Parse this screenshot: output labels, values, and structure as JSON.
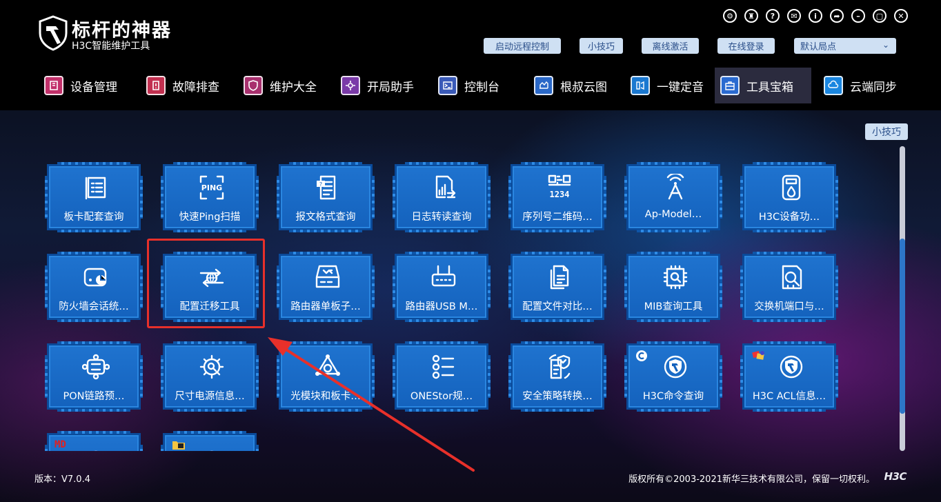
{
  "app": {
    "title": "标杆的神器",
    "subtitle": "H3C智能维护工具"
  },
  "window_controls": [
    {
      "name": "settings-icon",
      "glyph": "⚙"
    },
    {
      "name": "skin-icon",
      "glyph": "♜"
    },
    {
      "name": "help-icon",
      "glyph": "?"
    },
    {
      "name": "mail-icon",
      "glyph": "✉"
    },
    {
      "name": "info-icon",
      "glyph": "i"
    },
    {
      "name": "share-icon",
      "glyph": "➦"
    },
    {
      "name": "minimize-icon",
      "glyph": "–"
    },
    {
      "name": "maximize-icon",
      "glyph": "▢"
    },
    {
      "name": "close-icon",
      "glyph": "✕"
    }
  ],
  "quick_buttons": {
    "remote": "启动远程控制",
    "tips": "小技巧",
    "offline_activate": "离线激活",
    "online_login": "在线登录",
    "office_select": "默认局点"
  },
  "nav": [
    {
      "label": "设备管理",
      "color": "#c2306a"
    },
    {
      "label": "故障排查",
      "color": "#c23050"
    },
    {
      "label": "维护大全",
      "color": "#a8306e"
    },
    {
      "label": "开局助手",
      "color": "#7a3aa8"
    },
    {
      "label": "控制台",
      "color": "#3a5ab8"
    },
    {
      "label": "根叔云图",
      "color": "#2a68c8"
    },
    {
      "label": "一键定音",
      "color": "#1a78d0"
    },
    {
      "label": "工具宝箱",
      "color": "#2a6ad0"
    },
    {
      "label": "云端同步",
      "color": "#1a86e0"
    }
  ],
  "active_nav": "工具宝箱",
  "tips_badge": "小技巧",
  "scroll_position": 0.31,
  "tools": [
    {
      "label": "板卡配套查询",
      "icon": "list-icon"
    },
    {
      "label": "快速Ping扫描",
      "icon": "ping-scan-icon",
      "icon_text": "PING"
    },
    {
      "label": "报文格式查询",
      "icon": "document-query-icon"
    },
    {
      "label": "日志转读查询",
      "icon": "log-icon"
    },
    {
      "label": "序列号二维码…",
      "icon": "qr-code-icon",
      "icon_text": "1234"
    },
    {
      "label": "Ap-Model…",
      "icon": "antenna-icon"
    },
    {
      "label": "H3C设备功…",
      "icon": "device-power-icon"
    },
    {
      "label": "防火墙会话统…",
      "icon": "firewall-chart-icon"
    },
    {
      "label": "配置迁移工具",
      "icon": "config-migrate-icon"
    },
    {
      "label": "路由器单板子…",
      "icon": "router-board-icon"
    },
    {
      "label": "路由器USB M…",
      "icon": "router-usb-icon"
    },
    {
      "label": "配置文件对比…",
      "icon": "file-compare-icon"
    },
    {
      "label": "MIB查询工具",
      "icon": "mib-chip-icon"
    },
    {
      "label": "交换机端口与…",
      "icon": "switch-port-icon"
    },
    {
      "label": "PON链路预…",
      "icon": "pon-link-icon"
    },
    {
      "label": "尺寸电源信息…",
      "icon": "gear-search-icon"
    },
    {
      "label": "光模块和板卡…",
      "icon": "optical-module-icon"
    },
    {
      "label": "ONEStor规…",
      "icon": "onestor-list-icon"
    },
    {
      "label": "安全策略转换…",
      "icon": "security-policy-icon"
    },
    {
      "label": "H3C命令查询",
      "icon": "h3c-command-icon"
    },
    {
      "label": "H3C ACL信息…",
      "icon": "h3c-acl-icon"
    },
    {
      "label": "",
      "icon": "h3c-logo-icon",
      "badge": "MD"
    },
    {
      "label": "",
      "icon": "h3c-logo-icon"
    }
  ],
  "footer": {
    "version": "版本：V7.0.4",
    "copyright": "版权所有©2003-2021新华三技术有限公司，保留一切权利。",
    "brand": "H3C"
  }
}
